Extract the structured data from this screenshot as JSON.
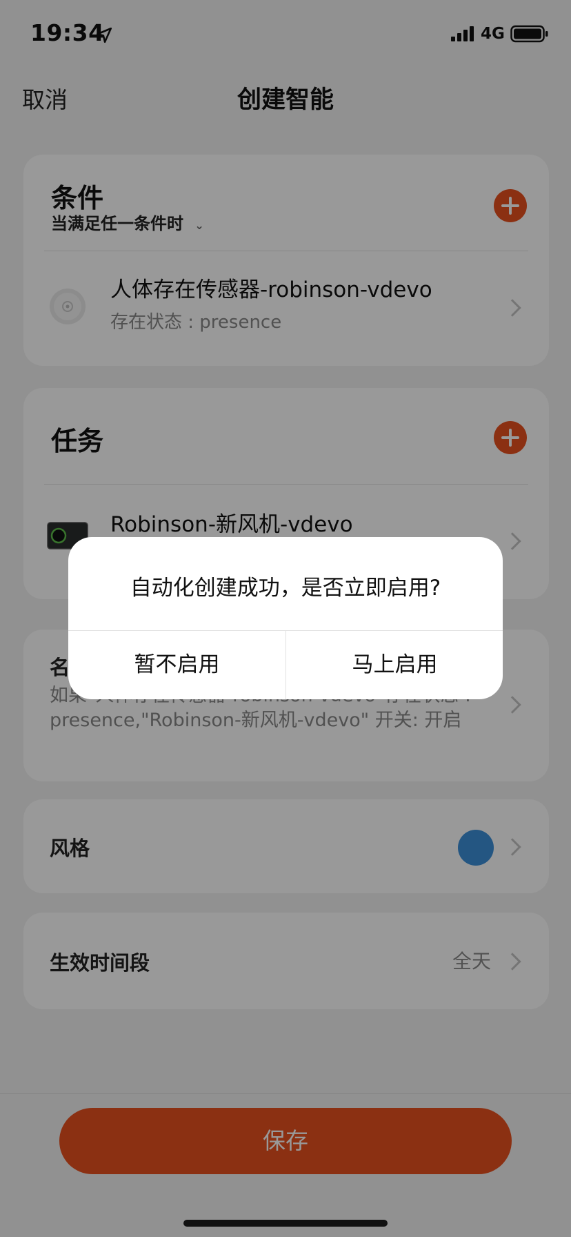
{
  "status_bar": {
    "time": "19:34",
    "network": "4G"
  },
  "nav": {
    "cancel": "取消",
    "title": "创建智能"
  },
  "conditions": {
    "title": "条件",
    "mode": "当满足任一条件时",
    "items": [
      {
        "title": "人体存在传感器-robinson-vdevo",
        "subtitle": "存在状态 : presence"
      }
    ]
  },
  "tasks": {
    "title": "任务",
    "items": [
      {
        "title": "Robinson-新风机-vdevo"
      }
    ]
  },
  "name_row": {
    "label": "名",
    "description": "如果\"人体存在传感器-robinson-vdevo\"存在状态 : presence,\"Robinson-新风机-vdevo\" 开关: 开启"
  },
  "style_row": {
    "label": "风格",
    "color": "#3d8fd9"
  },
  "period_row": {
    "label": "生效时间段",
    "value": "全天"
  },
  "save_label": "保存",
  "dialog": {
    "message": "自动化创建成功，是否立即启用?",
    "cancel_label": "暂不启用",
    "confirm_label": "马上启用"
  },
  "colors": {
    "accent": "#e8511f",
    "overlay": "rgba(0,0,0,0.40)"
  }
}
